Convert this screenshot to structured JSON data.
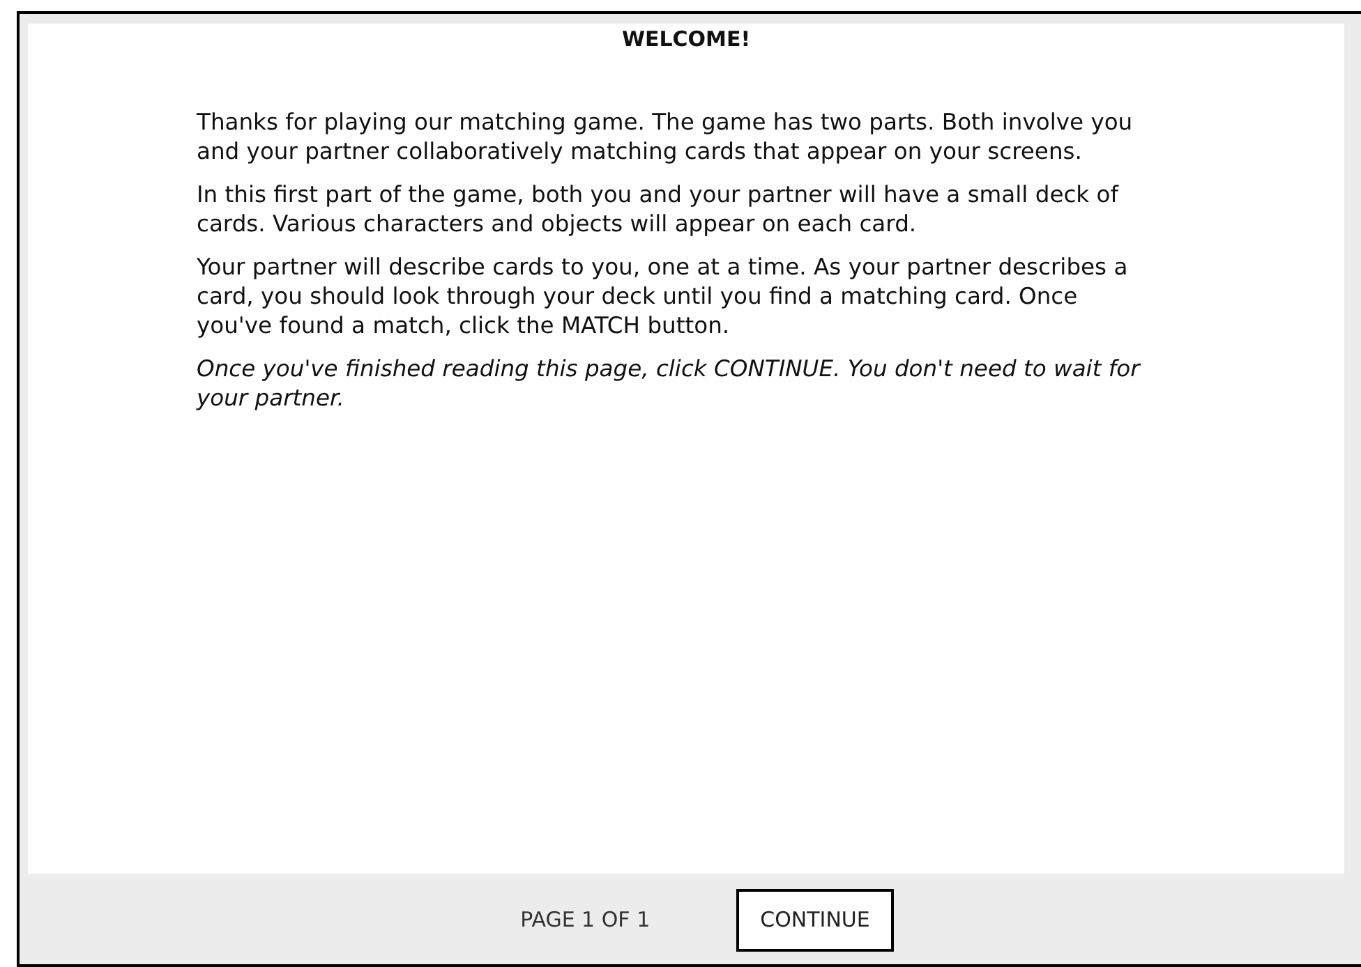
{
  "title": "WELCOME!",
  "paragraphs": [
    {
      "kind": "normal",
      "text": "Thanks for playing our matching game. The game has two parts. Both involve you and your partner collaboratively matching cards that appear on your screens."
    },
    {
      "kind": "normal",
      "text": "In this first part of the game, both you and your partner will have a small deck of cards. Various characters and objects will appear on each card."
    },
    {
      "kind": "normal",
      "text": "Your partner will describe cards to you, one at a time. As your partner describes a card, you should look through your deck until you find a matching card. Once you've found a match, click the MATCH button."
    },
    {
      "kind": "italic",
      "text": "Once you've finished reading this page, click CONTINUE. You don't need to wait for your partner."
    }
  ],
  "footer": {
    "page_indicator": "PAGE 1 OF 1",
    "button": "CONTINUE"
  }
}
